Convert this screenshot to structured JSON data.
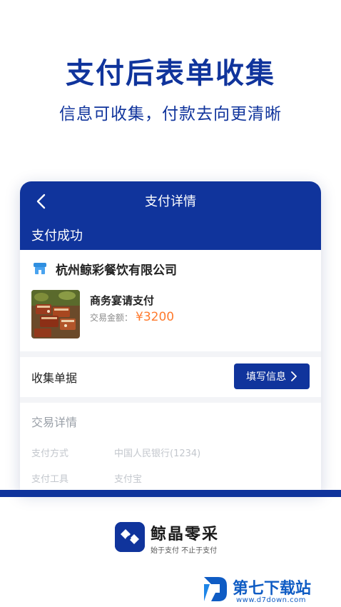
{
  "promo": {
    "headline": "支付后表单收集",
    "subline": "信息可收集，付款去向更清晰"
  },
  "payment_screen": {
    "title": "支付详情",
    "status": "支付成功",
    "merchant": "杭州鲸彩餐饮有限公司",
    "order_title": "商务宴请支付",
    "amount_label": "交易金额：",
    "amount": "¥3200",
    "collect_label": "收集单据",
    "fill_button": "填写信息",
    "details_title": "交易详情",
    "details": [
      {
        "label": "支付方式",
        "value": "中国人民银行(1234)"
      },
      {
        "label": "支付工具",
        "value": "支付宝"
      }
    ]
  },
  "brand": {
    "name": "鲸晶零采",
    "tagline": "始于支付 不止于支付"
  },
  "watermark": {
    "text": "第七下载站",
    "url": "www.d7down.com"
  },
  "colors": {
    "primary": "#10349c",
    "amount": "#ff7a2d",
    "watermark": "#0f5cc4"
  }
}
